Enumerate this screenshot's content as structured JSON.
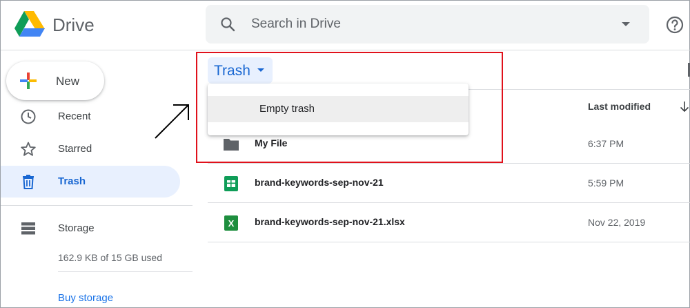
{
  "app": {
    "title": "Drive"
  },
  "search": {
    "placeholder": "Search in Drive"
  },
  "sidebar": {
    "new_label": "New",
    "items": [
      {
        "label": "Recent"
      },
      {
        "label": "Starred"
      },
      {
        "label": "Trash"
      },
      {
        "label": "Storage"
      }
    ],
    "storage_used": "162.9 KB of 15 GB used",
    "buy_storage": "Buy storage"
  },
  "main": {
    "location_label": "Trash",
    "column_header": "Last modified",
    "menu": {
      "items": [
        {
          "label": "Empty trash"
        }
      ]
    },
    "files": [
      {
        "name": "My File",
        "date": "6:37 PM",
        "icon": "folder-icon"
      },
      {
        "name": "brand-keywords-sep-nov-21",
        "date": "5:59 PM",
        "icon": "google-sheets-icon"
      },
      {
        "name": "brand-keywords-sep-nov-21.xlsx",
        "date": "Nov 22, 2019",
        "icon": "excel-icon"
      }
    ]
  },
  "colors": {
    "accent": "#1a73e8",
    "active_bg": "#e8f0fe",
    "annotation_red": "#e0111b",
    "sheets_green": "#0f9d58"
  }
}
